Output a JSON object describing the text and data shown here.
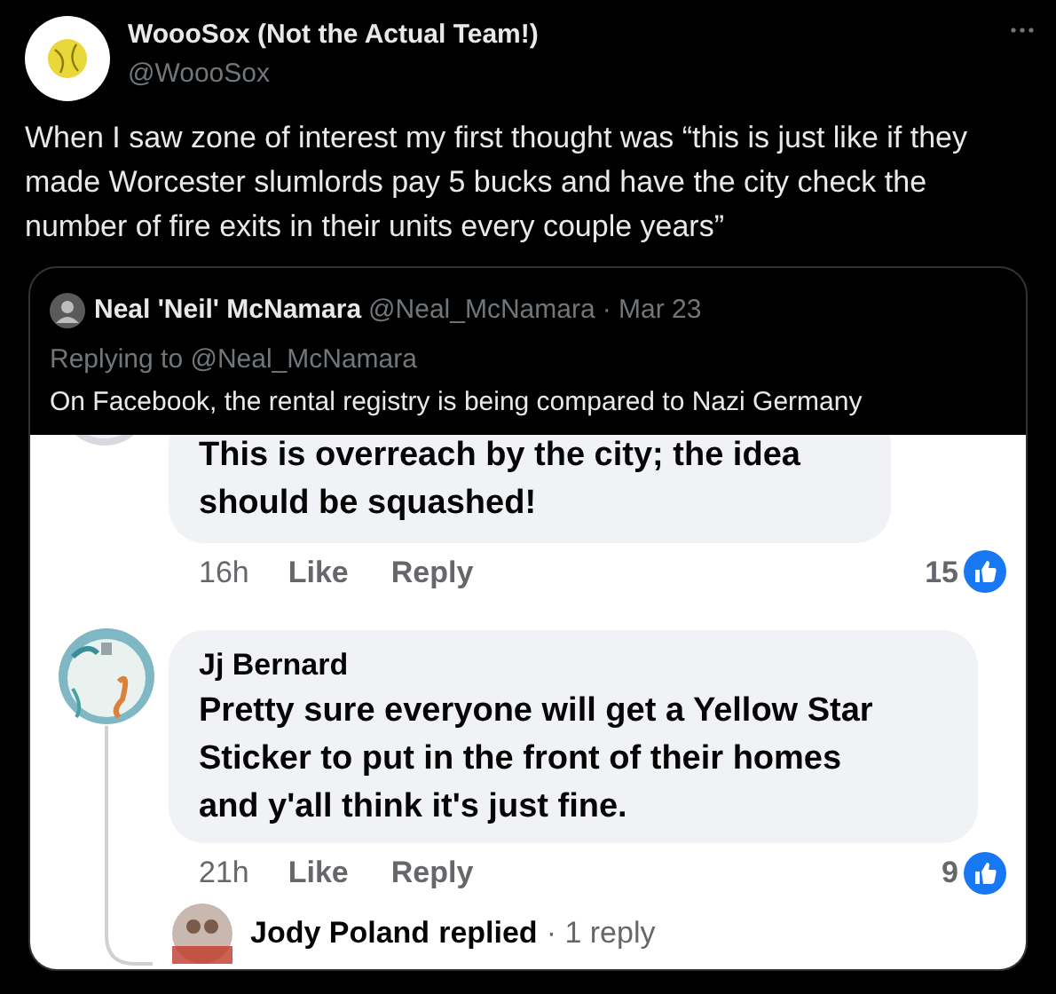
{
  "tweet": {
    "author": {
      "name": "WoooSox (Not the Actual Team!)",
      "handle": "@WoooSox"
    },
    "text": "When I saw zone of interest my first thought was “this is just like if they made Worcester slumlords pay 5 bucks and have the city check the number of fire exits in their units every couple years”",
    "quoted_tweet": {
      "author": {
        "name": "Neal 'Neil' McNamara",
        "handle": "@Neal_McNamara",
        "date": "· Mar 23"
      },
      "replying_to": "Replying to @Neal_McNamara",
      "text": "On Facebook, the rental registry is being compared to Nazi Germany",
      "image": {
        "comments": [
          {
            "text": "This is overreach by the city; the idea should be squashed!",
            "time": "16h",
            "like": "Like",
            "reply": "Reply",
            "reactions": "15"
          },
          {
            "name": "Jj Bernard",
            "text": "Pretty sure everyone will get a Yellow Star Sticker to put in the front of their homes and y'all think it's just fine.",
            "time": "21h",
            "like": "Like",
            "reply": "Reply",
            "reactions": "9"
          }
        ],
        "collapsed_reply": {
          "name": "Jody Poland",
          "action": "replied",
          "count": "· 1 reply"
        }
      }
    }
  }
}
